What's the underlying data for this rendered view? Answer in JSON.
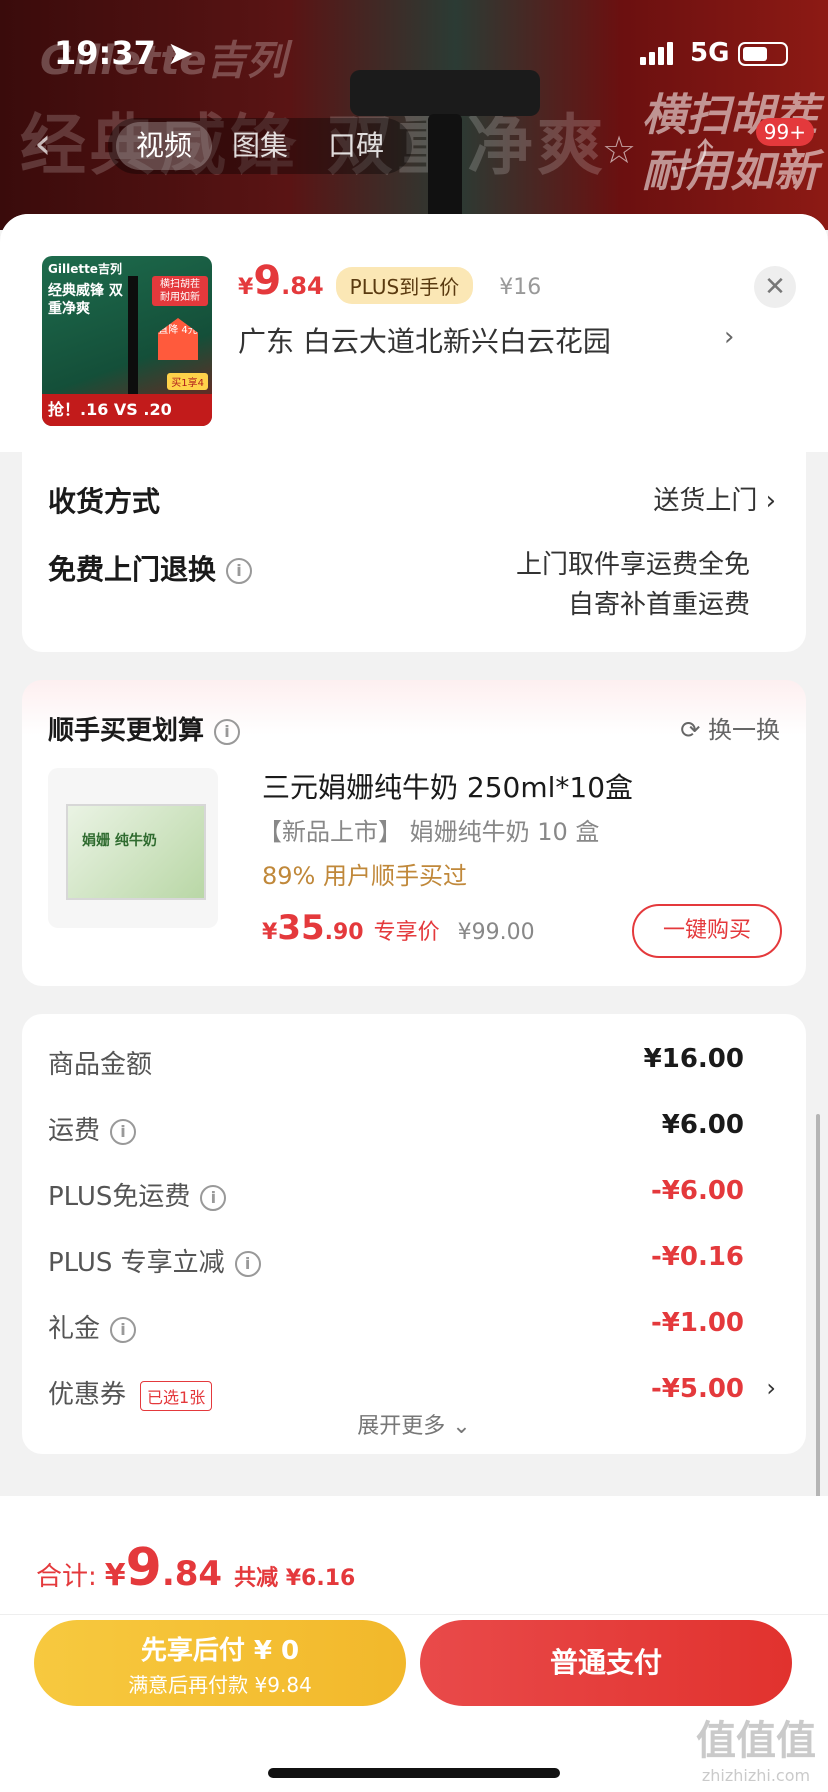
{
  "status": {
    "time": "19:37",
    "network": "5G"
  },
  "background": {
    "brand": "Gillette吉列",
    "slogan_left": "经典威锋 双重净爽",
    "slogan_right": "横扫胡茬 耐用如新",
    "badge": "99+",
    "tabs": [
      "视频",
      "图集",
      "口碑"
    ],
    "active_tab": "视频"
  },
  "header": {
    "thumb": {
      "brand": "Gillette吉列",
      "slogan": "经典威锋 双重净爽",
      "tag": "横扫胡茬 耐用如新",
      "drop": "直降 4元",
      "plus": "买1享4",
      "bottom": "抢！.16 VS .20"
    },
    "price_symbol": "¥",
    "price_int": "9",
    "price_dec": ".84",
    "plus_tag": "PLUS到手价",
    "orig_price": "¥16",
    "address": "广东  白云大道北新兴白云花园"
  },
  "delivery": {
    "method_label": "收货方式",
    "method_value": "送货上门",
    "return_label": "免费上门退换",
    "return_value_1": "上门取件享运费全免",
    "return_value_2": "自寄补首重运费"
  },
  "upsell": {
    "title": "顺手买更划算",
    "refresh": "换一换",
    "product_name": "三元娟姗纯牛奶 250ml*10盒",
    "product_sub": "【新品上市】 娟姗纯牛奶 10 盒",
    "product_pct": "89% 用户顺手买过",
    "product_img_text": "娟姗 纯牛奶",
    "price_symbol": "¥",
    "price_int": "35",
    "price_dec": ".90",
    "price_label": "专享价",
    "orig_price": "¥99.00",
    "buy_label": "一键购买"
  },
  "summary": {
    "rows": [
      {
        "label": "商品金额",
        "value": "¥16.00"
      },
      {
        "label": "运费",
        "value": "¥6.00"
      },
      {
        "label": "PLUS免运费",
        "value": "-¥6.00"
      },
      {
        "label": "PLUS 专享立减",
        "value": "-¥0.16"
      },
      {
        "label": "礼金",
        "value": "-¥1.00"
      },
      {
        "label": "优惠券",
        "value": "-¥5.00",
        "tag": "已选1张"
      }
    ],
    "expand": "展开更多"
  },
  "footer": {
    "total_label": "合计:",
    "total_symbol": "¥",
    "total_int": "9",
    "total_dec": ".84",
    "total_save": "共减 ¥6.16",
    "pay_later_1": "先享后付 ¥ 0",
    "pay_later_2": "满意后再付款 ¥9.84",
    "pay_normal": "普通支付"
  },
  "watermark": {
    "main": "值值值",
    "sub": "zhizhizhi.com"
  },
  "colors": {
    "accent": "#e4393c",
    "gold": "#f2b82b",
    "plus": "#fbe7b5"
  }
}
